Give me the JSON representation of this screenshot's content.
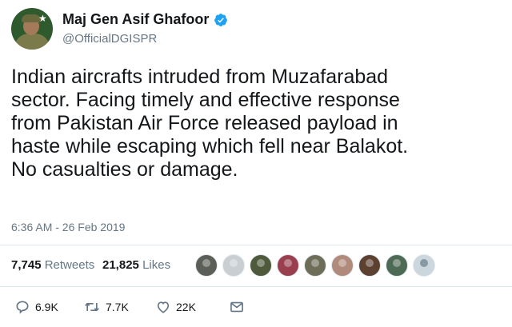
{
  "author": {
    "name": "Maj Gen Asif Ghafoor",
    "handle": "@OfficialDGISPR",
    "verified": true
  },
  "tweet": {
    "text": "Indian aircrafts intruded from Muzafarabad\nsector. Facing timely and effective response\nfrom Pakistan Air Force released payload in\nhaste while escaping which fell near Balakot.\nNo casualties or damage.",
    "timestamp": "6:36 AM - 26 Feb 2019"
  },
  "stats": {
    "retweets_count": "7,745",
    "retweets_label": "Retweets",
    "likes_count": "21,825",
    "likes_label": "Likes",
    "liker_avatars": [
      {
        "color": "#5b5f58"
      },
      {
        "color": "#c9ced3"
      },
      {
        "color": "#4f5a3c"
      },
      {
        "color": "#9a3f4e"
      },
      {
        "color": "#6e6e58"
      },
      {
        "color": "#b08a7a"
      },
      {
        "color": "#5c4030"
      },
      {
        "color": "#4d6a55"
      },
      {
        "color": "generic"
      }
    ]
  },
  "actions": {
    "reply_count": "6.9K",
    "retweet_count": "7.7K",
    "like_count": "22K",
    "icons": [
      "reply-icon",
      "retweet-icon",
      "like-icon",
      "direct-message-icon"
    ]
  },
  "colors": {
    "text": "#14171a",
    "secondary": "#657786",
    "verified": "#1da1f2",
    "divider": "#e1e8ed"
  }
}
